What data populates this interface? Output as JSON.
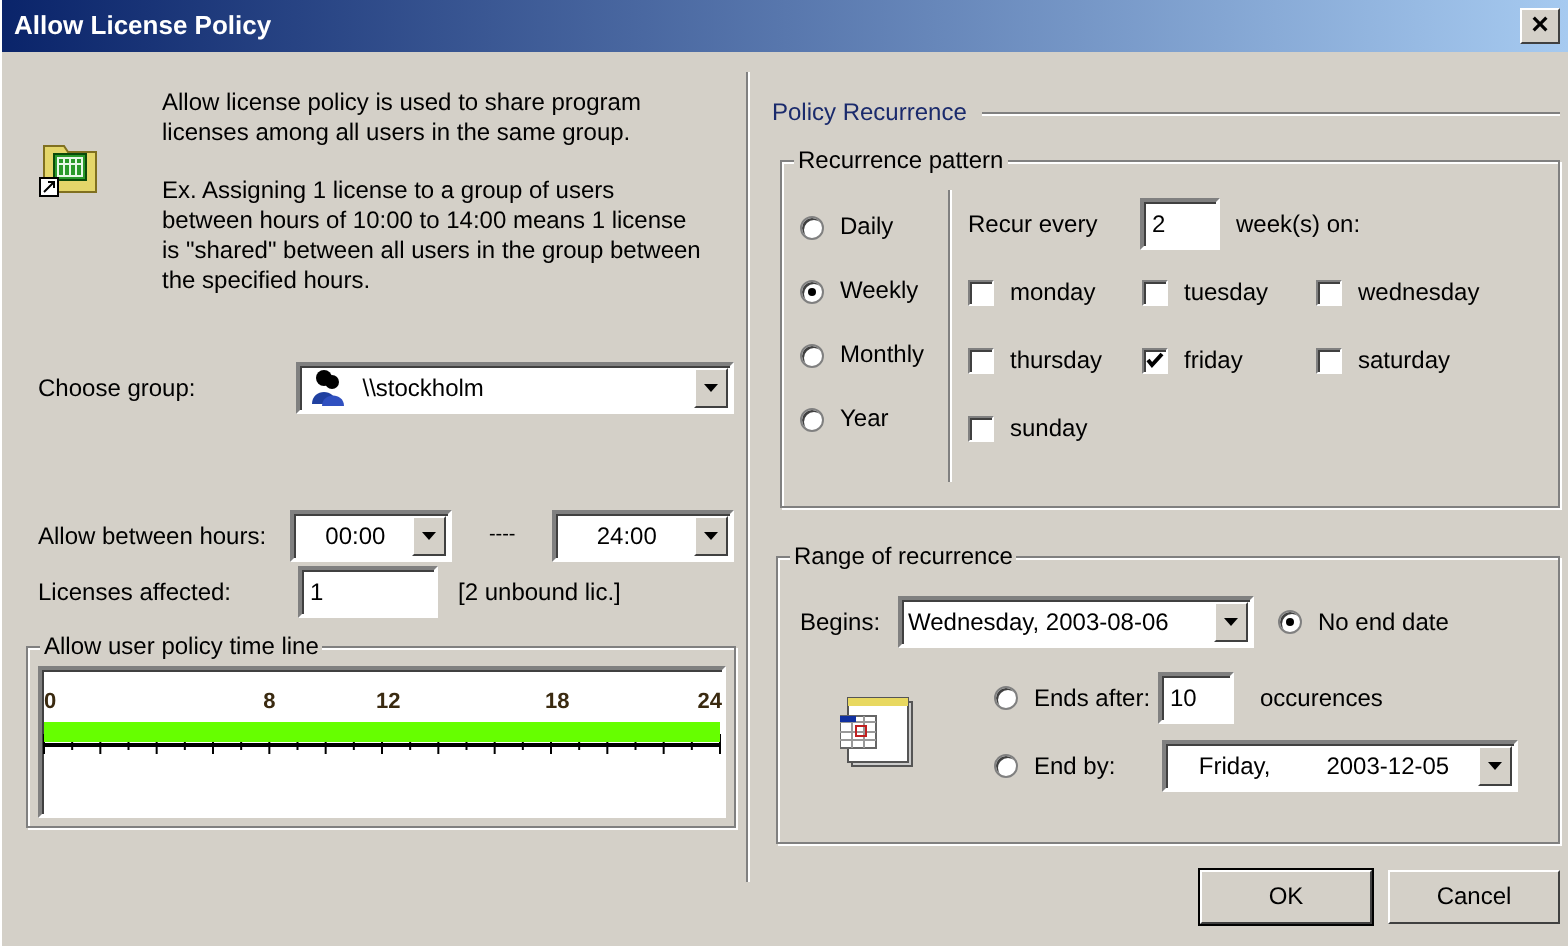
{
  "window": {
    "title": "Allow License Policy",
    "close": "×"
  },
  "description": [
    "Allow license policy is used to share program licenses among all users in the same group.",
    "Ex. Assigning 1 license to a group of users between hours of 10:00 to 14:00 means 1 license is \"shared\" between all users in the group between the specified hours."
  ],
  "group": {
    "label": "Choose group:",
    "value": "\\\\stockholm"
  },
  "hours": {
    "label": "Allow between hours:",
    "from": "00:00",
    "separator": "----",
    "to": "24:00"
  },
  "licenses": {
    "label": "Licenses affected:",
    "value": "1",
    "note": "[2 unbound lic.]"
  },
  "timeline": {
    "title": "Allow user policy time line",
    "labels": [
      "0",
      "8",
      "12",
      "18",
      "24"
    ],
    "level": 1
  },
  "recurrence": {
    "title": "Policy Recurrence",
    "pattern": {
      "title": "Recurrence pattern",
      "options": [
        {
          "label": "Daily",
          "selected": false
        },
        {
          "label": "Weekly",
          "selected": true
        },
        {
          "label": "Monthly",
          "selected": false
        },
        {
          "label": "Year",
          "selected": false
        }
      ],
      "recur_label": "Recur every",
      "recur_value": "2",
      "recur_unit": "week(s) on:",
      "days": [
        {
          "label": "monday",
          "checked": false
        },
        {
          "label": "tuesday",
          "checked": false
        },
        {
          "label": "wednesday",
          "checked": false
        },
        {
          "label": "thursday",
          "checked": false
        },
        {
          "label": "friday",
          "checked": true
        },
        {
          "label": "saturday",
          "checked": false
        },
        {
          "label": "sunday",
          "checked": false
        }
      ]
    },
    "range": {
      "title": "Range of recurrence",
      "begins_label": "Begins:",
      "begins_value": "Wednesday, 2003-08-06",
      "end_options": [
        {
          "label": "No end date",
          "selected": true
        },
        {
          "label": "Ends after:",
          "selected": false
        },
        {
          "label": "End by:",
          "selected": false
        }
      ],
      "ends_after_value": "10",
      "ends_after_unit": "occurences",
      "end_by_day": "Friday,",
      "end_by_date": "2003-12-05"
    }
  },
  "buttons": [
    {
      "label": "OK",
      "default": true
    },
    {
      "label": "Cancel",
      "default": false
    }
  ]
}
